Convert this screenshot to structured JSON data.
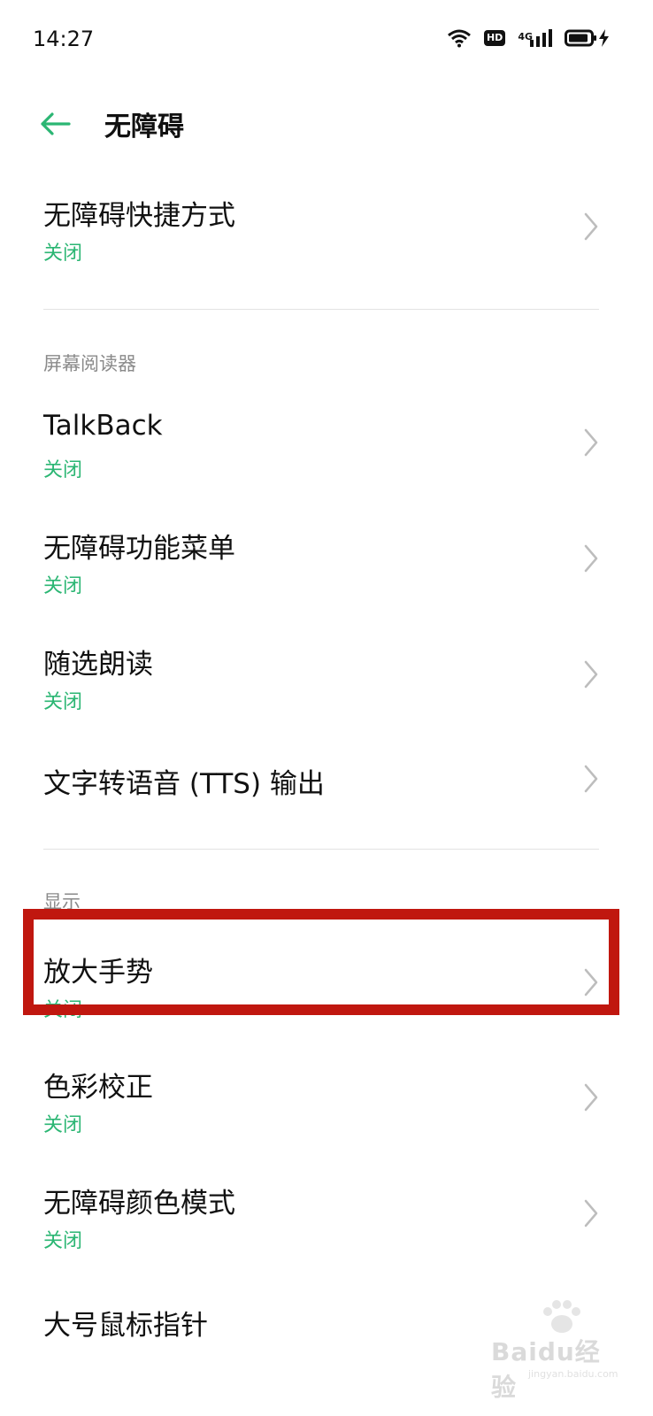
{
  "status": {
    "time": "14:27",
    "hd": "HD",
    "network": "4G"
  },
  "header": {
    "title": "无障碍"
  },
  "rows": [
    {
      "title": "无障碍快捷方式",
      "status": "关闭"
    },
    {
      "title": "TalkBack",
      "status": "关闭"
    },
    {
      "title": "无障碍功能菜单",
      "status": "关闭"
    },
    {
      "title": "随选朗读",
      "status": "关闭"
    },
    {
      "title": "文字转语音 (TTS) 输出"
    },
    {
      "title": "放大手势",
      "status": "关闭"
    },
    {
      "title": "色彩校正",
      "status": "关闭"
    },
    {
      "title": "无障碍颜色模式",
      "status": "关闭"
    },
    {
      "title": "大号鼠标指针"
    }
  ],
  "sections": {
    "screen_reader": "屏幕阅读器",
    "display": "显示"
  },
  "watermark": {
    "text": "Baidu经验",
    "sub": "jingyan.baidu.com"
  },
  "colors": {
    "accent": "#2bb673",
    "highlight": "#c0170f"
  }
}
